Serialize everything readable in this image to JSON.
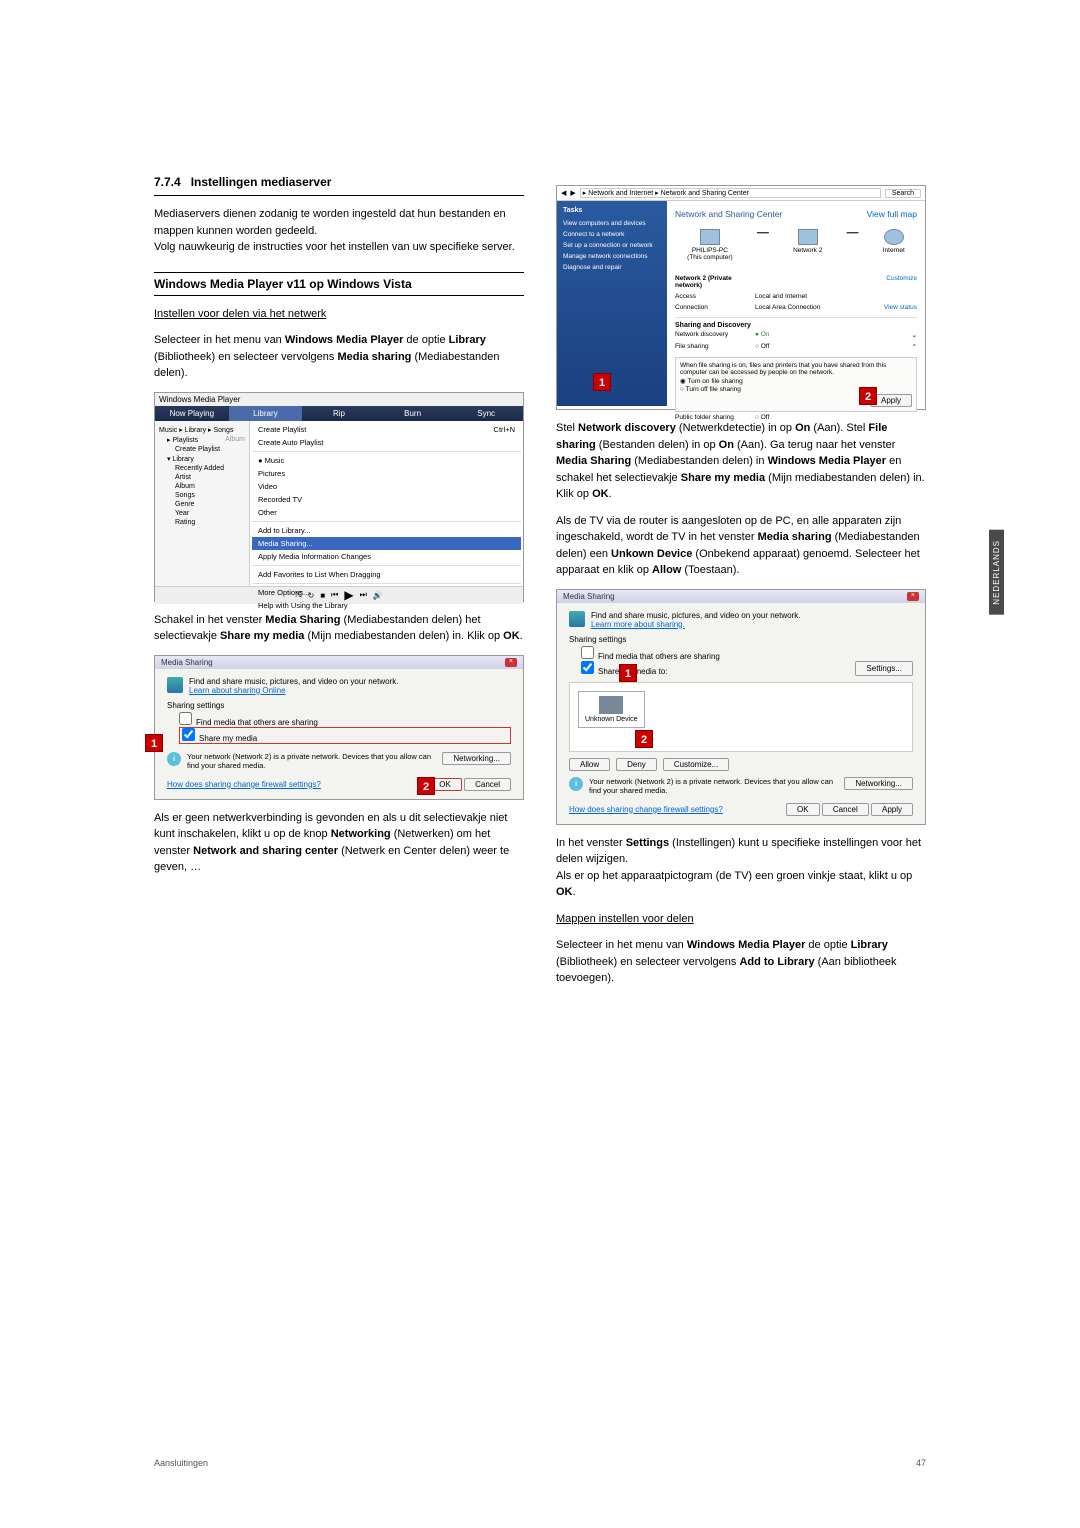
{
  "section_number": "7.7.4",
  "section_title": "Instellingen mediaserver",
  "left": {
    "intro": "Mediaservers dienen zodanig te worden ingesteld dat hun bestanden en mappen kunnen worden gedeeld.",
    "intro2": "Volg nauwkeurig de instructies voor het instellen van uw specifieke server.",
    "wmp_heading": "Windows Media Player v11 op Windows Vista",
    "net_share_title": "Instellen voor delen via het netwerk",
    "p1_a": "Selecteer in het menu van ",
    "p1_b": "Windows Media Player",
    "p1_c": " de optie ",
    "p1_d": "Library",
    "p1_e": " (Bibliotheek) en selecteer vervolgens ",
    "p1_f": "Media sharing",
    "p1_g": " (Mediabestanden delen).",
    "wmp": {
      "title": "Windows Media Player",
      "tabs": [
        "Now Playing",
        "Library",
        "Rip",
        "Burn",
        "Sync"
      ],
      "breadcrumb": "Music  ▸  Library  ▸  Songs",
      "album": "Album",
      "side": [
        "Playlists",
        "Create Playlist",
        "Library",
        "Recently Added",
        "Artist",
        "Album",
        "Songs",
        "Genre",
        "Year",
        "Rating"
      ],
      "menu": [
        {
          "t": "Create Playlist",
          "s": "Ctrl+N"
        },
        {
          "t": "Create Auto Playlist"
        },
        {
          "sep": true
        },
        {
          "t": "Music",
          "dot": true
        },
        {
          "t": "Pictures"
        },
        {
          "t": "Video"
        },
        {
          "t": "Recorded TV"
        },
        {
          "t": "Other"
        },
        {
          "sep": true
        },
        {
          "t": "Add to Library..."
        },
        {
          "t": "Media Sharing...",
          "hl": true
        },
        {
          "t": "Apply Media Information Changes"
        },
        {
          "sep": true
        },
        {
          "t": "Add Favorites to List When Dragging"
        },
        {
          "sep": true
        },
        {
          "t": "More Options..."
        },
        {
          "t": "Help with Using the Library"
        }
      ]
    },
    "p2_a": "Schakel in het venster ",
    "p2_b": "Media Sharing",
    "p2_c": " (Mediabestanden delen) het selectievakje ",
    "p2_d": "Share my media",
    "p2_e": " (Mijn mediabestanden delen) in. Klik op ",
    "p2_f": "OK",
    "p2_g": ".",
    "dlg1": {
      "title": "Media Sharing",
      "desc": "Find and share music, pictures, and video on your network.",
      "link": "Learn about sharing Online",
      "settings": "Sharing settings",
      "c1": "Find media that others are sharing",
      "c2": "Share my media",
      "info1": "Your network (Network 2) is a private network. Devices that you allow can find your shared media.",
      "networking": "Networking...",
      "firewall": "How does sharing change firewall settings?",
      "ok": "OK",
      "cancel": "Cancel"
    },
    "p3": "Als er geen netwerkverbinding is gevonden en als u dit selectievakje niet kunt inschakelen, klikt u op de knop ",
    "p3_b": "Networking",
    "p3_c": " (Netwerken) om het venster ",
    "p3_d": "Network and sharing center",
    "p3_e": " (Netwerk en Center delen) weer te geven, …"
  },
  "right": {
    "vista": {
      "breadcrumb": "▸ Network and Internet ▸ Network and Sharing Center",
      "search": "Search",
      "tasks_label": "Tasks",
      "tasks": [
        "View computers and devices",
        "Connect to a network",
        "Set up a connection or network",
        "Manage network connections",
        "Diagnose and repair"
      ],
      "header": "Network and Sharing Center",
      "viewmap": "View full map",
      "net_items": [
        {
          "n": "PHILIPS-PC",
          "s": "(This computer)"
        },
        {
          "n": "Network 2",
          "s": ""
        },
        {
          "n": "Internet",
          "s": ""
        }
      ],
      "net2": "Network 2 (Private network)",
      "customize": "Customize",
      "r1": {
        "a": "Access",
        "b": "Local and Internet"
      },
      "r2": {
        "a": "Connection",
        "b": "Local Area Connection",
        "c": "View status"
      },
      "sd": "Sharing and Discovery",
      "r3": {
        "a": "Network discovery",
        "b": "● On"
      },
      "r4": {
        "a": "File sharing",
        "b": "○ Off"
      },
      "box_txt": "When file sharing is on, files and printers that you have shared from this computer can be accessed by people on the network.",
      "radio1": "Turn on file sharing",
      "radio2": "Turn off file sharing",
      "apply": "Apply",
      "pfs": "Public folder sharing",
      "pfs_v": "○ Off"
    },
    "p1_a": "Stel ",
    "p1_b": "Network discovery",
    "p1_c": " (Netwerkdetectie) in op ",
    "p1_d": "On",
    "p1_e": " (Aan). Stel ",
    "p1_f": "File sharing",
    "p1_g": " (Bestanden delen) in op ",
    "p1_h": "On",
    "p1_i": " (Aan). Ga terug naar het venster ",
    "p1_j": "Media Sharing",
    "p1_k": " (Mediabestanden delen) in ",
    "p1_l": "Windows Media Player",
    "p1_m": " en schakel het selectievakje ",
    "p1_n": "Share my media",
    "p1_o": " (Mijn mediabestanden delen) in. Klik op ",
    "p1_p": "OK",
    "p1_q": ".",
    "p2_a": "Als de TV via de router is aangesloten op de PC, en alle apparaten zijn ingeschakeld, wordt de TV in het venster ",
    "p2_b": "Media sharing",
    "p2_c": " (Mediabestanden delen) een ",
    "p2_d": "Unkown Device",
    "p2_e": " (Onbekend apparaat) genoemd. Selecteer het apparaat en klik op ",
    "p2_f": "Allow",
    "p2_g": " (Toestaan).",
    "dlg2": {
      "title": "Media Sharing",
      "desc": "Find and share music, pictures, and video on your network.",
      "link": "Learn more about sharing.",
      "settings": "Sharing settings",
      "c1": "Find media that others are sharing",
      "c2": "Share my media to:",
      "btn_settings": "Settings...",
      "device": "Unknown Device",
      "allow": "Allow",
      "deny": "Deny",
      "customize": "Customize...",
      "info": "Your network (Network 2) is a private network. Devices that you allow can find your shared media.",
      "networking": "Networking...",
      "firewall": "How does sharing change firewall settings?",
      "ok": "OK",
      "cancel": "Cancel",
      "apply": "Apply"
    },
    "p3_a": "In het venster ",
    "p3_b": "Settings",
    "p3_c": " (Instellingen) kunt u specifieke instellingen voor het delen wijzigen.",
    "p3_d": "Als er op het apparaatpictogram (de TV) een groen vinkje staat, klikt u op ",
    "p3_e": "OK",
    "p3_f": ".",
    "folders_title": "Mappen instellen voor delen",
    "p4_a": "Selecteer in het menu van ",
    "p4_b": "Windows Media Player",
    "p4_c": " de optie ",
    "p4_d": "Library",
    "p4_e": " (Bibliotheek) en selecteer vervolgens ",
    "p4_f": "Add to Library",
    "p4_g": " (Aan bibliotheek toevoegen)."
  },
  "side_tab": "NEDERLANDS",
  "footer_left": "Aansluitingen",
  "footer_right": "47",
  "badges": {
    "one": "1",
    "two": "2"
  }
}
